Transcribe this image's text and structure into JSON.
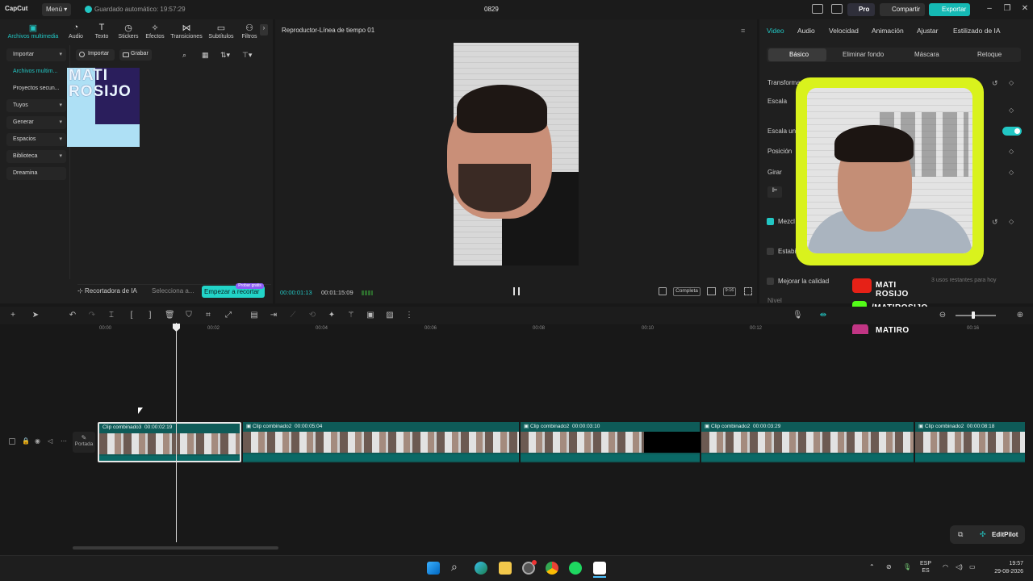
{
  "app": {
    "logo": "CapCut",
    "menu_label": "Menú",
    "autosave": "Guardado automático: 19:57:29",
    "project_title": "0829",
    "pro_label": "Pro",
    "share_label": "Compartir",
    "export_label": "Exportar"
  },
  "left_panel": {
    "tabs": [
      {
        "label": "Archivos multimedia",
        "icon": "media-icon"
      },
      {
        "label": "Audio",
        "icon": "audio-icon"
      },
      {
        "label": "Texto",
        "icon": "text-icon"
      },
      {
        "label": "Stickers",
        "icon": "sticker-icon"
      },
      {
        "label": "Efectos",
        "icon": "effects-icon"
      },
      {
        "label": "Transiciones",
        "icon": "transitions-icon"
      },
      {
        "label": "Subtítulos",
        "icon": "subtitles-icon"
      },
      {
        "label": "Filtros",
        "icon": "filters-icon"
      }
    ],
    "side_items": [
      "Importar",
      "Archivos multim...",
      "Proyectos secun...",
      "Tuyos",
      "Generar",
      "Espacios",
      "Biblioteca",
      "Dreamina"
    ],
    "import_button": "Importar",
    "record_button": "Grabar",
    "thumbnail_text": "MATI ROSIJO",
    "ai_cropper": "Recortadora de IA",
    "ai_select": "Selecciona a...",
    "start_crop": "Empezar a recortar",
    "start_crop_badge": "Probar gratis"
  },
  "player": {
    "title": "Reproductor-Línea de tiempo 01",
    "current_time": "00:00:01:13",
    "total_time": "00:01:15:09",
    "full_label": "Completa",
    "ratio_label": "9:16"
  },
  "right_panel": {
    "tabs": [
      "Video",
      "Audio",
      "Velocidad",
      "Animación",
      "Ajustar",
      "Estilizado de IA"
    ],
    "subtabs": [
      "Básico",
      "Eliminar fondo",
      "Máscara",
      "Retoque"
    ],
    "props": {
      "transform": "Transformación",
      "scale": "Escala",
      "uniform_scale": "Escala unif",
      "position": "Posición",
      "rotate": "Girar",
      "blend": "Mezcl",
      "stabilize": "Estabili",
      "quality": "Mejorar la calidad",
      "quality_note": "3 usos restantes para hoy",
      "level": "Nivel"
    }
  },
  "overlay": {
    "youtube": "MATI ROSIJO",
    "kick": "/MATIROSIJO",
    "instagram": "MATIRO"
  },
  "timeline": {
    "ruler": [
      "00:00",
      "00:02",
      "00:04",
      "00:06",
      "00:08",
      "00:10",
      "00:12",
      "00:16"
    ],
    "cover_label": "Portada",
    "clips": [
      {
        "name": "Clip combinado3",
        "duration": "00:00:02:19"
      },
      {
        "name": "Clip combinado2",
        "duration": "00:00:05:04"
      },
      {
        "name": "Clip combinado2",
        "duration": "00:00:03:10"
      },
      {
        "name": "Clip combinado2",
        "duration": "00:00:03:29"
      },
      {
        "name": "Clip combinado2",
        "duration": "00:00:08:18"
      }
    ],
    "editpilot": "EditPilot"
  },
  "taskbar": {
    "lang_top": "ESP",
    "lang_bottom": "ES",
    "time": "19:57",
    "date": "29-08-2026"
  },
  "colors": {
    "accent": "#22c7c4",
    "overlay_frame": "#d9f21d"
  }
}
